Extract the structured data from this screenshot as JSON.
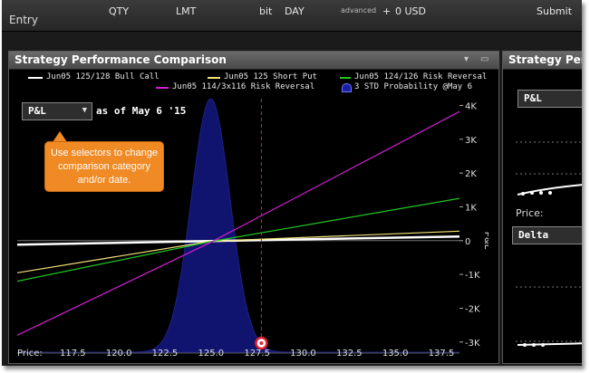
{
  "toolbar": {
    "entry_label": "Entry",
    "qty_label": "QTY",
    "lmt_label": "LMT",
    "dir_label": "bit",
    "day_label": "DAY",
    "advanced_label": "advanced",
    "currency_label": "0 USD",
    "submit_label": "Submit"
  },
  "panel": {
    "title": "Strategy Performance Comparison",
    "right_title": "Strategy Perf",
    "selector_value": "P&L",
    "as_of": "as of May 6 '15",
    "callout": "Use selectors to change comparison category and/or date.",
    "price_label": "Price:"
  },
  "right_panel": {
    "selector1": "P&L",
    "price_label": "Price:",
    "selector2": "Delta"
  },
  "legend": [
    {
      "label": "Jun05 125/128 Bull Call",
      "color": "#ffffff"
    },
    {
      "label": "Jun05 125 Short Put",
      "color": "#f2e27a"
    },
    {
      "label": "Jun05 124/126 Risk Reversal",
      "color": "#22c422"
    },
    {
      "label": "Jun05 114/3x116 Risk Reversal",
      "color": "#d21fd2"
    },
    {
      "label": "3 STD Probability @May 6",
      "color": "#1a1fa0"
    }
  ],
  "chart_data": {
    "type": "line",
    "xlabel": "Price:",
    "ylabel": "P&L",
    "xlim": [
      114.5,
      138.5
    ],
    "ylim": [
      -3300,
      4200
    ],
    "x_ticks": [
      "117.5",
      "120.0",
      "122.5",
      "125.0",
      "127.5",
      "130.0",
      "132.5",
      "135.0",
      "137.5"
    ],
    "y_ticks": [
      "4K",
      "3K",
      "2K",
      "1K",
      "0",
      "-1K",
      "-2K",
      "-3K"
    ],
    "current_price": 127.75,
    "series": [
      {
        "name": "Jun05 125/128 Bull Call",
        "color": "#ffffff",
        "x": [
          114.5,
          125,
          138.5
        ],
        "y": [
          -120,
          -10,
          120
        ]
      },
      {
        "name": "Jun05 125 Short Put",
        "color": "#f2e27a",
        "x": [
          114.5,
          125,
          138.5
        ],
        "y": [
          -950,
          -20,
          280
        ]
      },
      {
        "name": "Jun05 124/126 Risk Reversal",
        "color": "#22c422",
        "x": [
          114.5,
          125,
          138.5
        ],
        "y": [
          -1200,
          -30,
          1250
        ]
      },
      {
        "name": "Jun05 114/3x116 Risk Reversal",
        "color": "#d21fd2",
        "x": [
          114.5,
          125,
          138.5
        ],
        "y": [
          -2800,
          -50,
          3820
        ]
      }
    ],
    "probability": {
      "name": "3 STD Probability @May 6",
      "center": 125.0,
      "sigma": 1.05
    }
  }
}
